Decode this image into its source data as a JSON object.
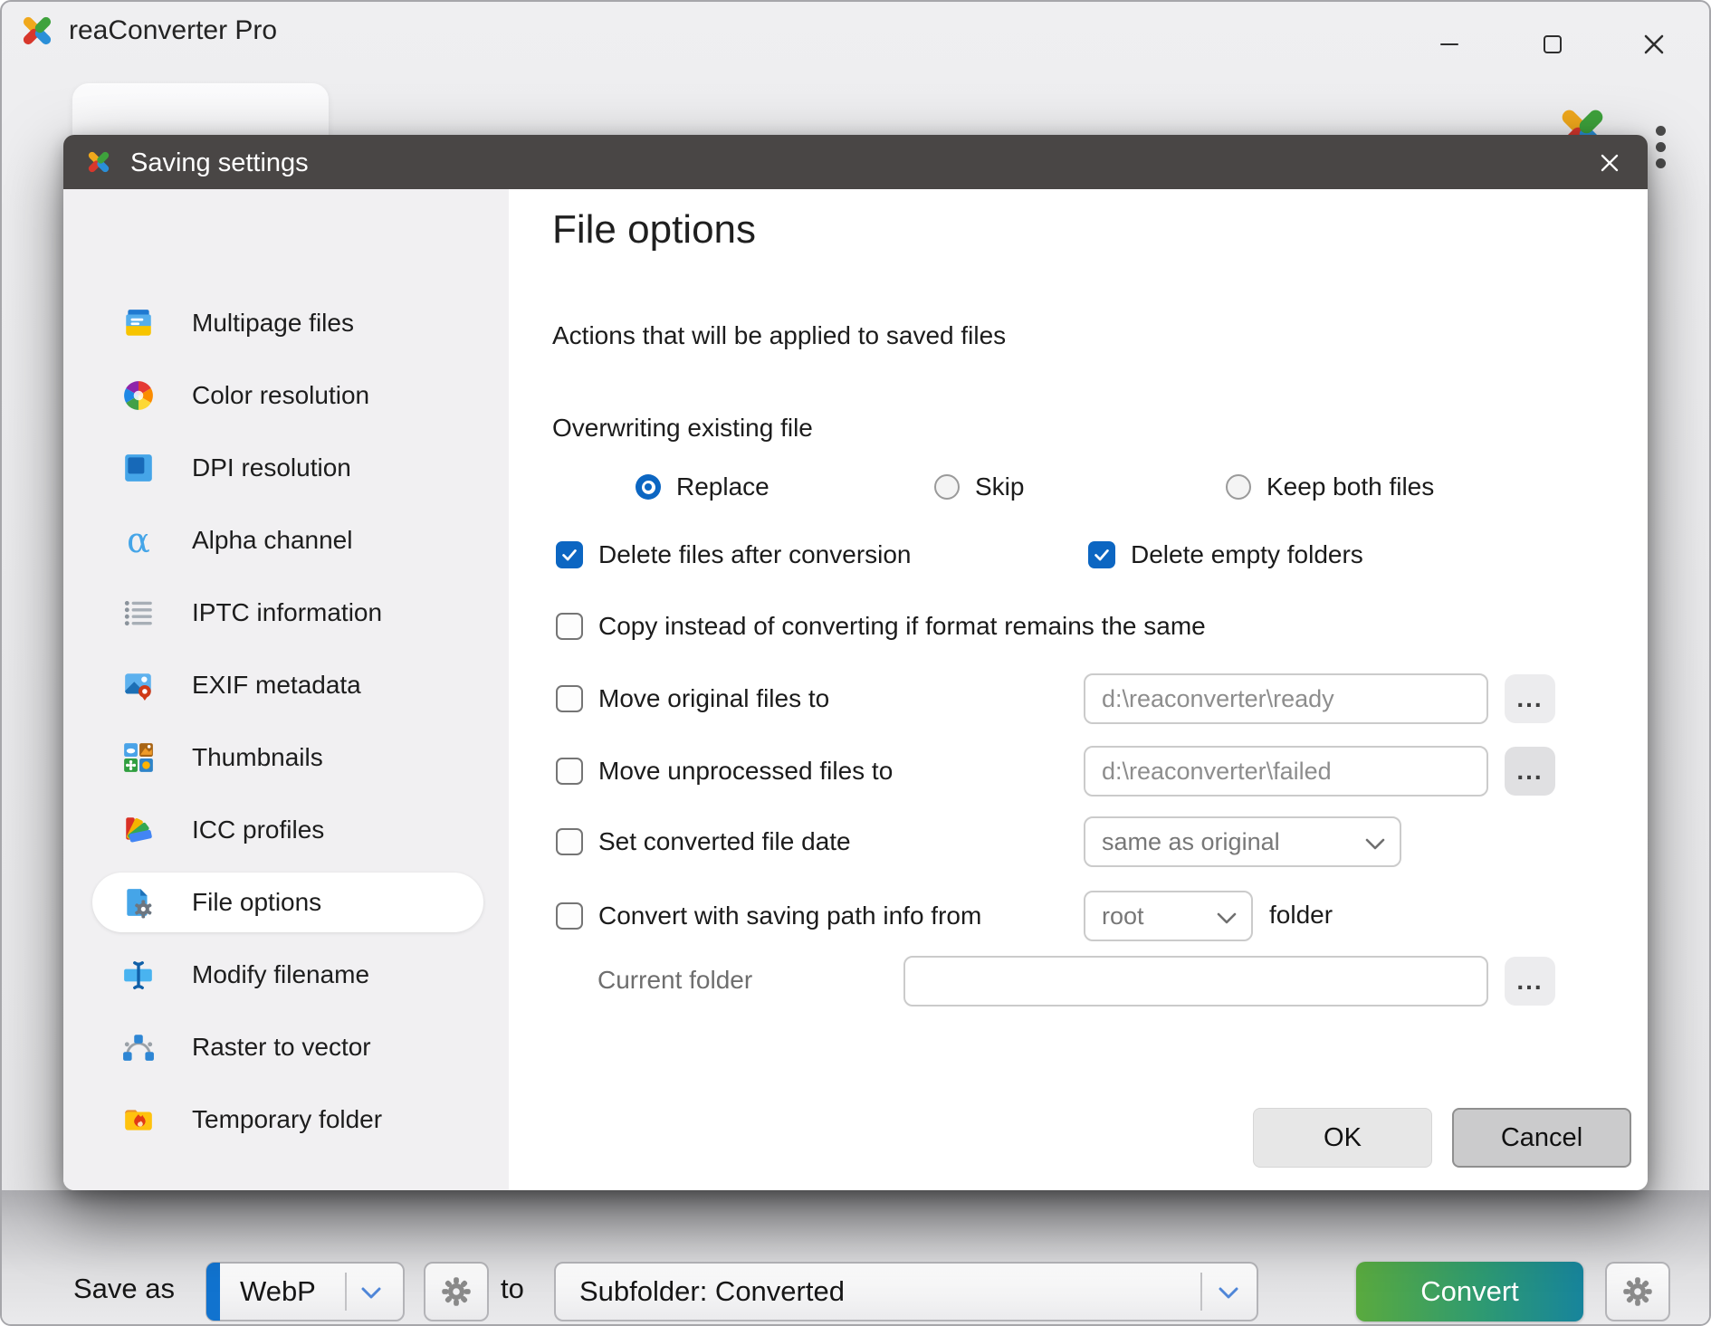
{
  "window": {
    "title": "reaConverter Pro"
  },
  "dialog": {
    "title": "Saving settings",
    "sidebar": {
      "items": [
        {
          "label": "Multipage files"
        },
        {
          "label": "Color resolution"
        },
        {
          "label": "DPI resolution"
        },
        {
          "label": "Alpha channel"
        },
        {
          "label": "IPTC information"
        },
        {
          "label": "EXIF metadata"
        },
        {
          "label": "Thumbnails"
        },
        {
          "label": "ICC profiles"
        },
        {
          "label": "File options"
        },
        {
          "label": "Modify filename"
        },
        {
          "label": "Raster to vector"
        },
        {
          "label": "Temporary folder"
        }
      ],
      "selected": "File options"
    },
    "panel": {
      "title": "File options",
      "subtitle": "Actions that will be applied to saved files",
      "overwrite_label": "Overwriting existing file",
      "radios": {
        "replace": "Replace",
        "skip": "Skip",
        "keep": "Keep both files",
        "selected": "Replace"
      },
      "checkboxes": {
        "delete_files": {
          "label": "Delete files after conversion",
          "checked": true
        },
        "delete_folders": {
          "label": "Delete empty folders",
          "checked": true
        },
        "copy_instead": {
          "label": "Copy instead of converting if format remains the same",
          "checked": false
        },
        "move_original": {
          "label": "Move original files to",
          "checked": false
        },
        "move_unprocessed": {
          "label": "Move unprocessed files to",
          "checked": false
        },
        "set_date": {
          "label": "Set converted file date",
          "checked": false
        },
        "convert_path": {
          "label": "Convert with saving path info from",
          "checked": false
        }
      },
      "fields": {
        "move_original_path": "d:\\reaconverter\\ready",
        "move_unprocessed_path": "d:\\reaconverter\\failed",
        "current_folder": ""
      },
      "selects": {
        "file_date": "same as original",
        "path_root": "root"
      },
      "labels": {
        "folder_suffix": "folder",
        "current_folder": "Current folder"
      },
      "browse": "...",
      "buttons": {
        "ok": "OK",
        "cancel": "Cancel"
      }
    }
  },
  "bottombar": {
    "save_as": "Save as",
    "format": "WebP",
    "to": "to",
    "destination": "Subfolder: Converted",
    "convert": "Convert"
  }
}
